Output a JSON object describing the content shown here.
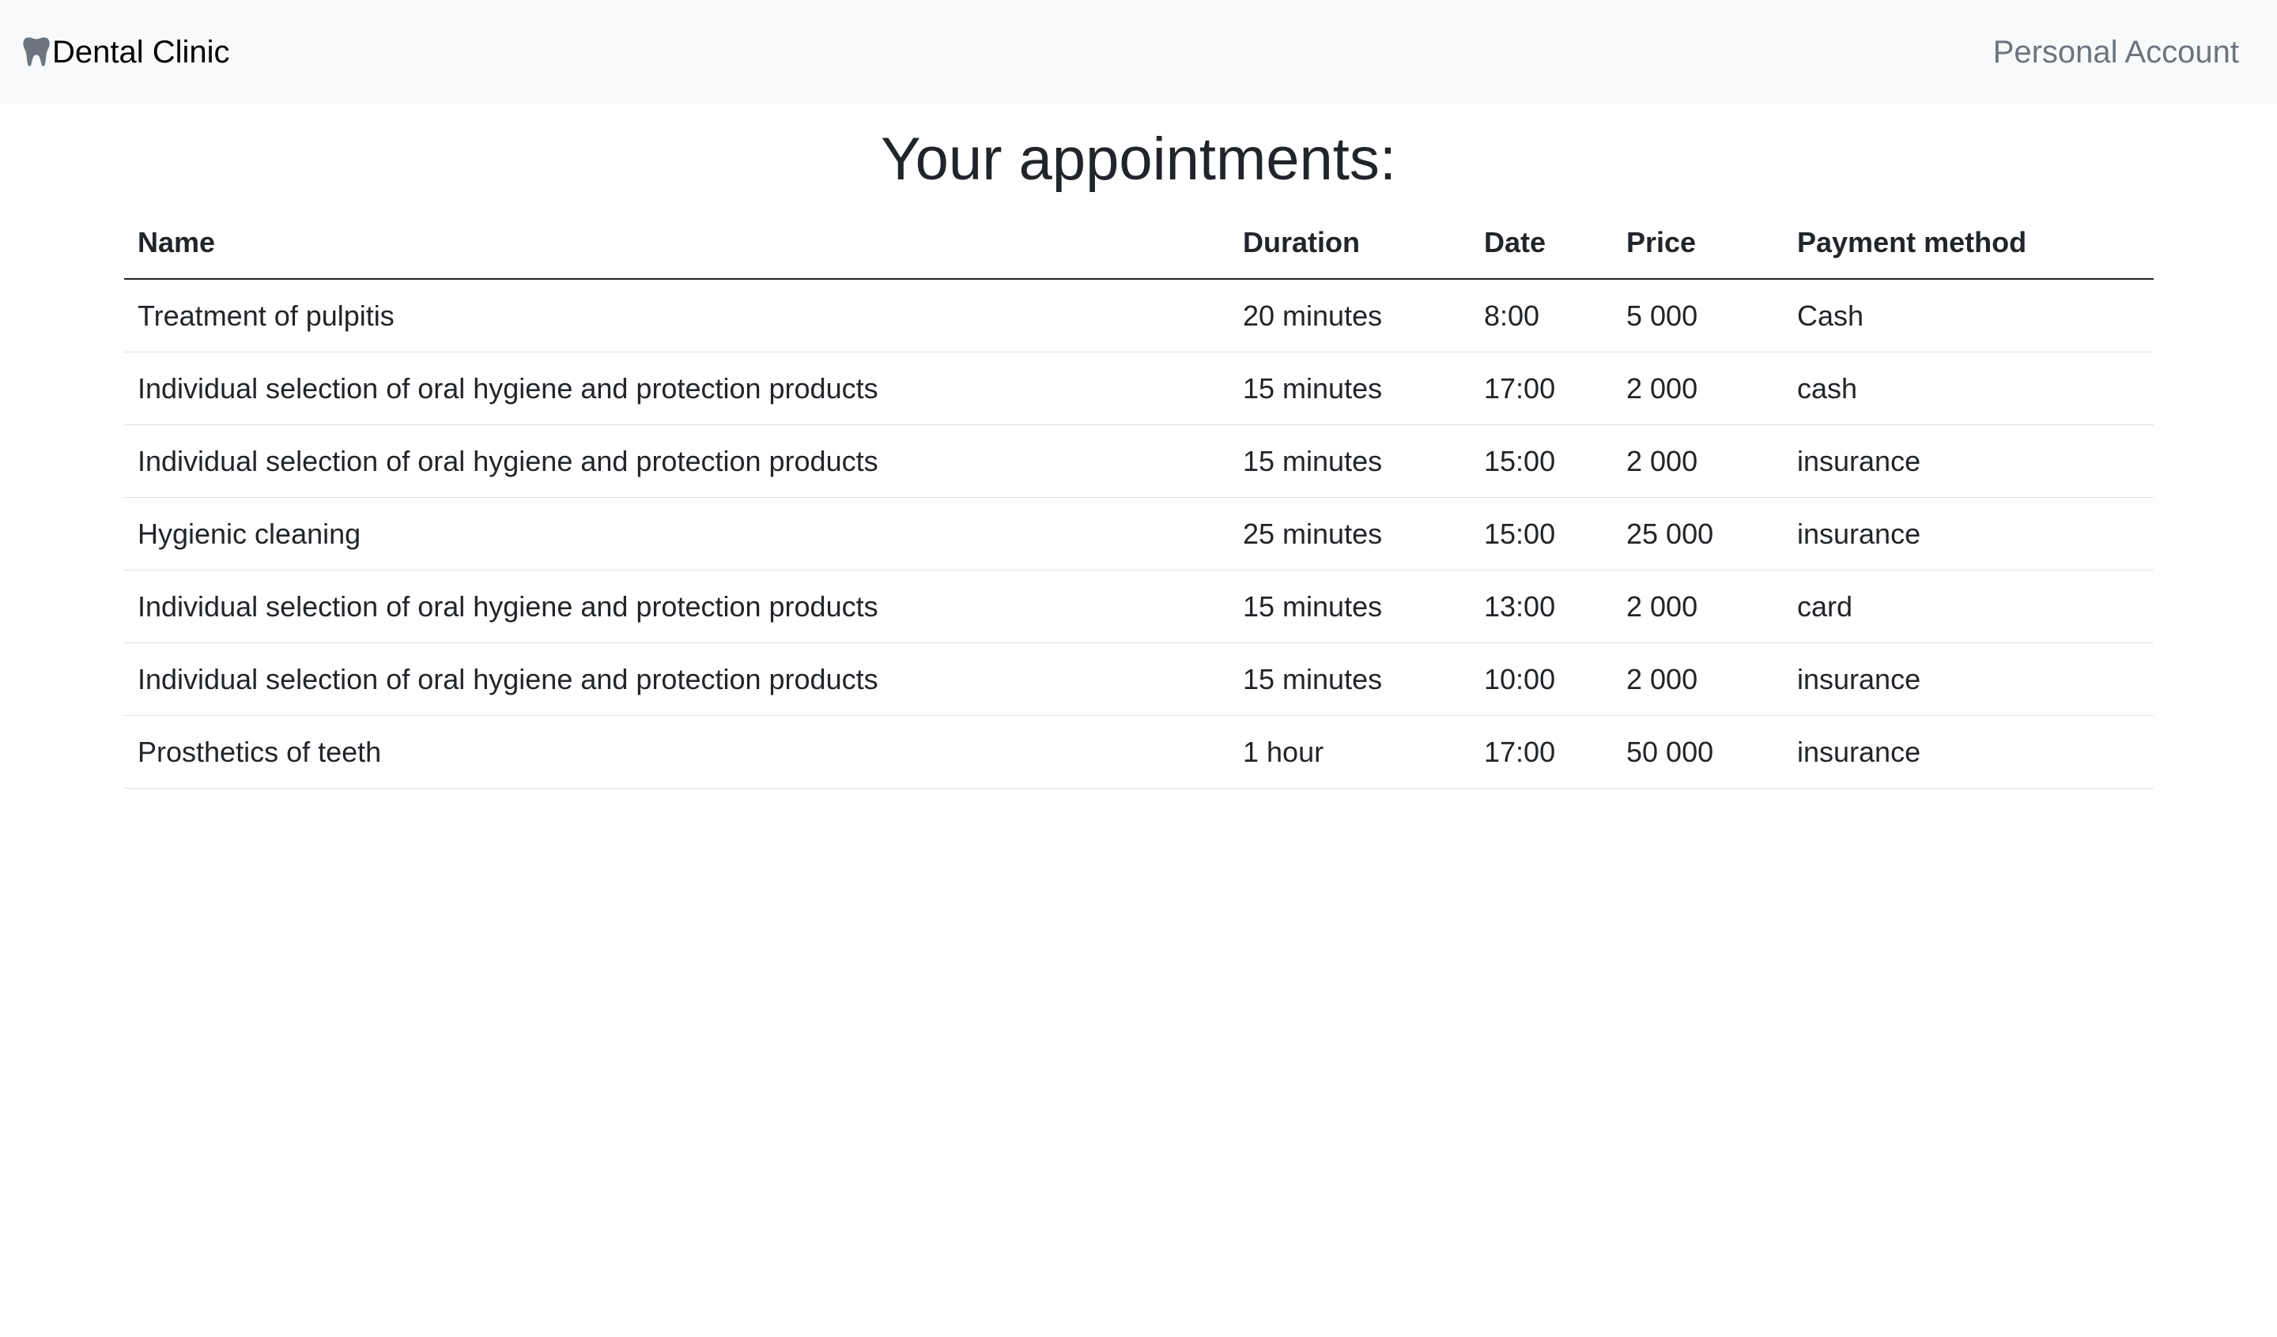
{
  "navbar": {
    "brand_icon": "tooth-icon",
    "brand": "Dental Clinic",
    "account_link": "Personal Account"
  },
  "page": {
    "title": "Your appointments:"
  },
  "table": {
    "headers": [
      "Name",
      "Duration",
      "Date",
      "Price",
      "Payment method"
    ],
    "rows": [
      [
        "Treatment of pulpitis",
        "20 minutes",
        "8:00",
        "5 000",
        "Cash"
      ],
      [
        "Individual selection of oral hygiene and protection products",
        "15 minutes",
        "17:00",
        "2 000",
        "cash"
      ],
      [
        "Individual selection of oral hygiene and protection products",
        "15 minutes",
        "15:00",
        "2 000",
        "insurance"
      ],
      [
        "Hygienic cleaning",
        "25 minutes",
        "15:00",
        "25 000",
        "insurance"
      ],
      [
        "Individual selection of oral hygiene and protection products",
        "15 minutes",
        "13:00",
        "2 000",
        "card"
      ],
      [
        "Individual selection of oral hygiene and protection products",
        "15 minutes",
        "10:00",
        "2 000",
        "insurance"
      ],
      [
        "Prosthetics of teeth",
        "1 hour",
        "17:00",
        "50 000",
        "insurance"
      ]
    ]
  },
  "colors": {
    "navbar_bg": "#f8f9fa",
    "text": "#212529",
    "muted": "#6c757d"
  }
}
